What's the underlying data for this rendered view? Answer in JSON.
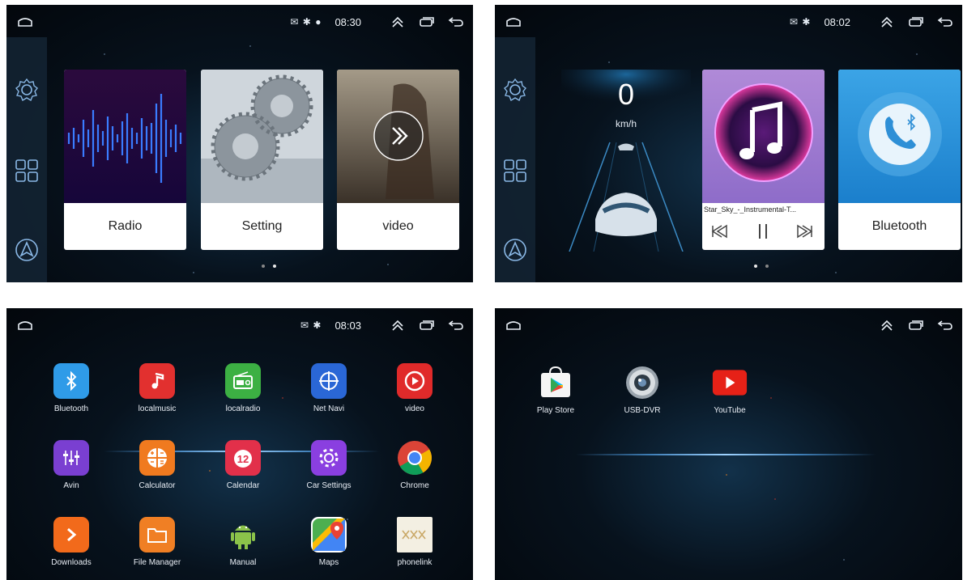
{
  "screen1": {
    "status": "✉ ✱ ●",
    "time": "08:30",
    "cards": [
      {
        "label": "Radio"
      },
      {
        "label": "Setting"
      },
      {
        "label": "video"
      }
    ],
    "page_dots": {
      "count": 2,
      "active": 2
    }
  },
  "screen2": {
    "status": "✉ ✱",
    "time": "08:02",
    "speed": {
      "value": "0",
      "unit": "km/h"
    },
    "music": {
      "track": "Star_Sky_-_Instrumental-T..."
    },
    "bluetooth_card": {
      "label": "Bluetooth"
    },
    "page_dots": {
      "count": 2,
      "active": 1
    }
  },
  "screen3": {
    "status": "✉ ✱",
    "time": "08:03",
    "apps": [
      {
        "label": "Bluetooth",
        "color": "#2f9be8",
        "icon": "bluetooth-icon"
      },
      {
        "label": "localmusic",
        "color": "#e2302f",
        "icon": "music-note-icon"
      },
      {
        "label": "localradio",
        "color": "#3cb043",
        "icon": "radio-icon"
      },
      {
        "label": "Net Navi",
        "color": "#2a67d6",
        "icon": "navigation-icon"
      },
      {
        "label": "video",
        "color": "#e02a2a",
        "icon": "play-icon"
      },
      {
        "label": "Avin",
        "color": "#7a3fd1",
        "icon": "equalizer-icon"
      },
      {
        "label": "Calculator",
        "color": "#f07a1f",
        "icon": "calculator-icon"
      },
      {
        "label": "Calendar",
        "color": "#e2304a",
        "icon": "calendar-icon"
      },
      {
        "label": "Car Settings",
        "color": "#8a3fe0",
        "icon": "gear-icon"
      },
      {
        "label": "Chrome",
        "color": "#ffffff",
        "icon": "chrome-icon"
      },
      {
        "label": "Downloads",
        "color": "#f26a1b",
        "icon": "download-icon"
      },
      {
        "label": "File Manager",
        "color": "#f07f24",
        "icon": "folder-icon"
      },
      {
        "label": "Manual",
        "color": "transparent",
        "icon": "android-icon"
      },
      {
        "label": "Maps",
        "color": "#ffffff",
        "icon": "maps-icon"
      },
      {
        "label": "phonelink",
        "color": "#f3efe2",
        "icon": "phonelink-icon"
      }
    ],
    "calendar_number": "12"
  },
  "screen4": {
    "apps": [
      {
        "label": "Play Store",
        "icon": "play-store-icon"
      },
      {
        "label": "USB-DVR",
        "icon": "camera-lens-icon"
      },
      {
        "label": "YouTube",
        "icon": "youtube-icon"
      }
    ]
  }
}
